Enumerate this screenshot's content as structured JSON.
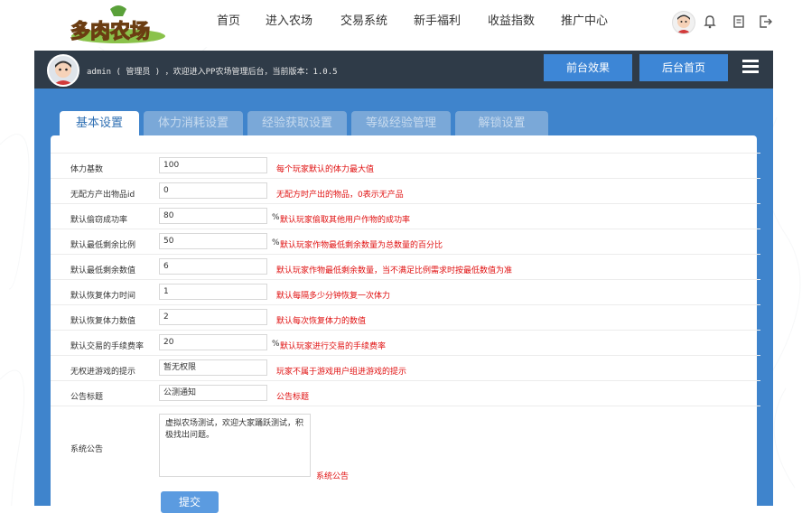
{
  "brand": {
    "logo_text": "多肉农场"
  },
  "topnav": {
    "items": [
      "首页",
      "进入农场",
      "交易系统",
      "新手福利",
      "收益指数",
      "推广中心"
    ]
  },
  "adminbar": {
    "welcome": "admin ( 管理员 ) ，欢迎进入PP农场管理后台，当前版本：1.0.5",
    "btn_front": "前台效果",
    "btn_home": "后台首页"
  },
  "tabs": [
    "基本设置",
    "体力消耗设置",
    "经验获取设置",
    "等级经验管理",
    "解锁设置"
  ],
  "form": {
    "rows": [
      {
        "label": "体力基数",
        "value": "100",
        "unit": "",
        "hint": "每个玩家默认的体力最大值"
      },
      {
        "label": "无配方产出物品id",
        "value": "0",
        "unit": "",
        "hint": "无配方时产出的物品，0表示无产品"
      },
      {
        "label": "默认偷窃成功率",
        "value": "80",
        "unit": "%",
        "hint": "默认玩家偷取其他用户作物的成功率"
      },
      {
        "label": "默认最低剩余比例",
        "value": "50",
        "unit": "%",
        "hint": "默认玩家作物最低剩余数量为总数量的百分比"
      },
      {
        "label": "默认最低剩余数值",
        "value": "6",
        "unit": "",
        "hint": "默认玩家作物最低剩余数量，当不满足比例需求时按最低数值为准"
      },
      {
        "label": "默认恢复体力时间",
        "value": "1",
        "unit": "",
        "hint": "默认每隔多少分钟恢复一次体力"
      },
      {
        "label": "默认恢复体力数值",
        "value": "2",
        "unit": "",
        "hint": "默认每次恢复体力的数值"
      },
      {
        "label": "默认交易的手续费率",
        "value": "20",
        "unit": "%",
        "hint": "默认玩家进行交易的手续费率"
      },
      {
        "label": "无权进游戏的提示",
        "value": "暂无权限",
        "unit": "",
        "hint": "玩家不属于游戏用户组进游戏的提示"
      },
      {
        "label": "公告标题",
        "value": "公测通知",
        "unit": "",
        "hint": "公告标题"
      }
    ],
    "announce": {
      "label": "系统公告",
      "value": "虚拟农场测试，欢迎大家踊跃测试，积极找出问题。",
      "hint": "系统公告"
    },
    "submit": "提交"
  }
}
